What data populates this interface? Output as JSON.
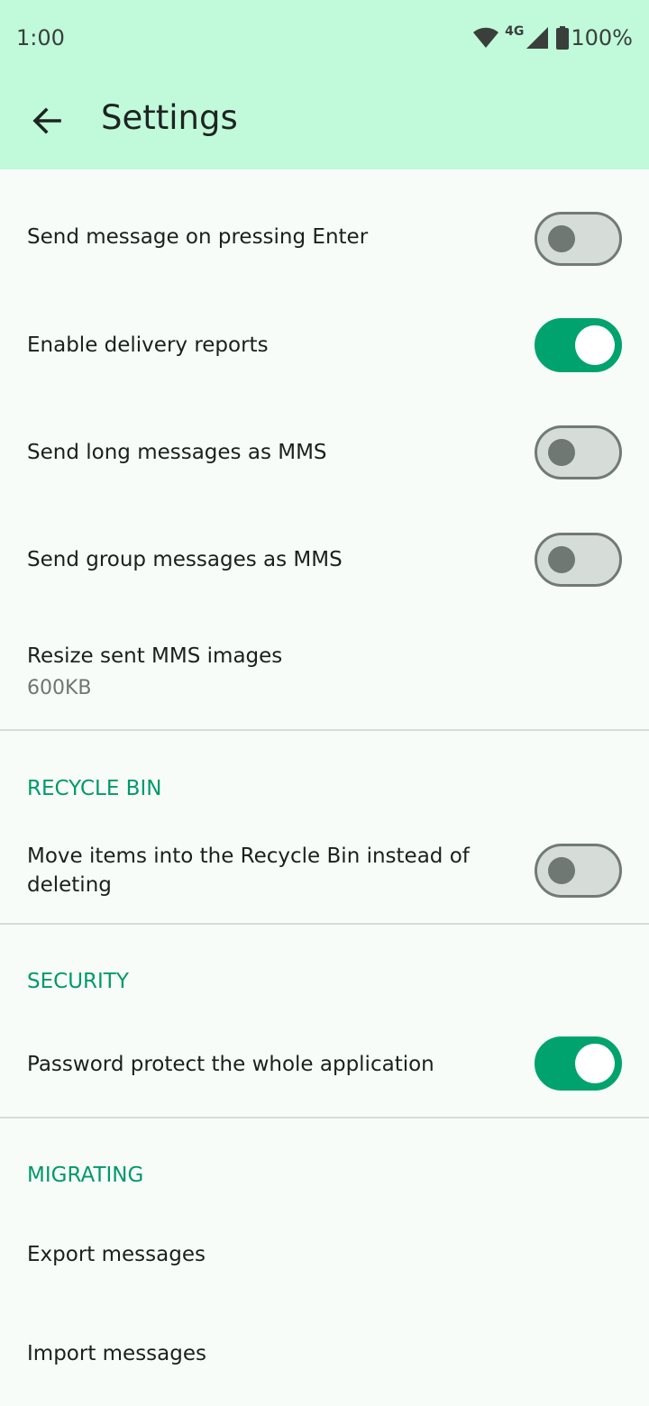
{
  "status_bar": {
    "time": "1:00",
    "network": "4G",
    "battery": "100%"
  },
  "app_bar": {
    "title": "Settings"
  },
  "colors": {
    "header_bg": "#c0fadb",
    "accent": "#00a36d",
    "section_header": "#00996a"
  },
  "settings": {
    "send_on_enter": {
      "label": "Send message on pressing Enter",
      "enabled": false
    },
    "delivery_reports": {
      "label": "Enable delivery reports",
      "enabled": true
    },
    "long_as_mms": {
      "label": "Send long messages as MMS",
      "enabled": false
    },
    "group_as_mms": {
      "label": "Send group messages as MMS",
      "enabled": false
    },
    "resize_mms": {
      "label": "Resize sent MMS images",
      "value": "600KB"
    }
  },
  "recycle_bin": {
    "header": "RECYCLE BIN",
    "move_to_bin": {
      "label": "Move items into the Recycle Bin instead of deleting",
      "enabled": false
    }
  },
  "security": {
    "header": "SECURITY",
    "password_protect": {
      "label": "Password protect the whole application",
      "enabled": true
    }
  },
  "migrating": {
    "header": "MIGRATING",
    "export": {
      "label": "Export messages"
    },
    "import": {
      "label": "Import messages"
    }
  }
}
